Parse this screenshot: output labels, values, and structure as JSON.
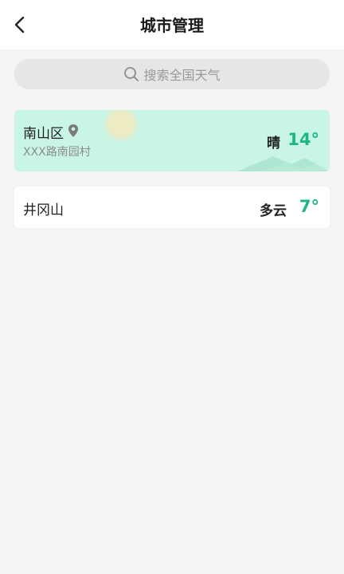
{
  "header": {
    "title": "城市管理",
    "back_icon": "chevron-left-icon"
  },
  "search": {
    "placeholder": "搜索全国天气",
    "icon": "search-icon"
  },
  "cities": [
    {
      "name": "南山区",
      "address": "XXX路南园村",
      "condition": "晴",
      "temperature": "14°",
      "location_icon": "location-pin-icon",
      "current": true,
      "background": "#c9f5e6"
    },
    {
      "name": "井冈山",
      "condition": "多云",
      "temperature": "7°",
      "current": false,
      "background": "#ffffff"
    }
  ],
  "colors": {
    "accent": "#1db784",
    "page_background": "#f4f4f4"
  }
}
